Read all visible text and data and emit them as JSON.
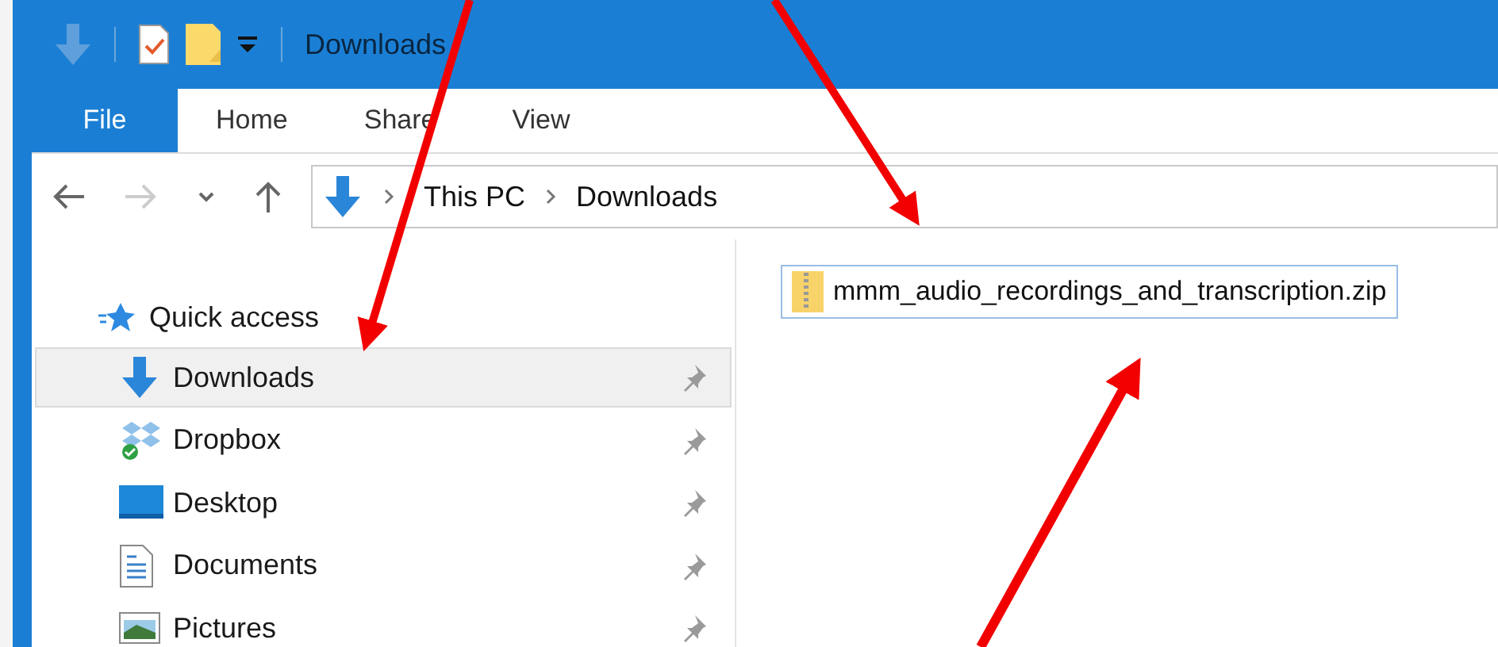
{
  "window": {
    "title": "Downloads"
  },
  "ribbon_tabs": [
    {
      "label": "File",
      "kind": "file"
    },
    {
      "label": "Home",
      "kind": "tab"
    },
    {
      "label": "Share",
      "kind": "tab"
    },
    {
      "label": "View",
      "kind": "tab"
    }
  ],
  "address_bar": {
    "path": [
      "This PC",
      "Downloads"
    ]
  },
  "sidebar": {
    "header": "Quick access",
    "items": [
      {
        "label": "Downloads",
        "kind": "downloads",
        "selected": true,
        "pinned": true
      },
      {
        "label": "Dropbox",
        "kind": "dropbox",
        "selected": false,
        "pinned": true
      },
      {
        "label": "Desktop",
        "kind": "desktop",
        "selected": false,
        "pinned": true
      },
      {
        "label": "Documents",
        "kind": "documents",
        "selected": false,
        "pinned": true
      },
      {
        "label": "Pictures",
        "kind": "pictures",
        "selected": false,
        "pinned": true
      }
    ]
  },
  "files": [
    {
      "name": "mmm_audio_recordings_and_transcription.zip",
      "selected": true
    }
  ]
}
